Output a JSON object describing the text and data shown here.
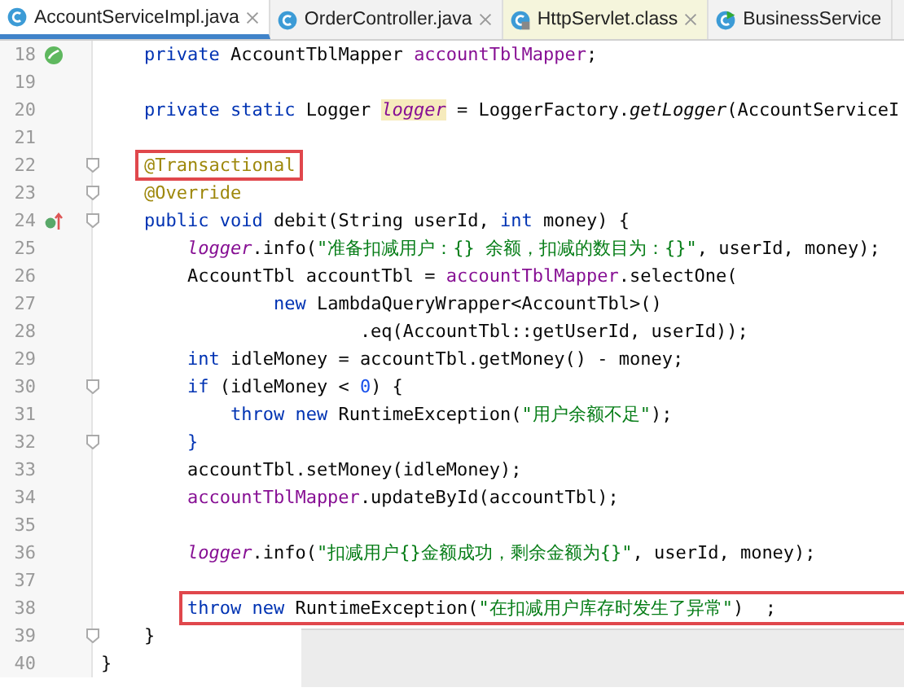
{
  "tabs": [
    {
      "label": "AccountServiceImpl.java",
      "selected": true,
      "kind": "java",
      "closable": true
    },
    {
      "label": "OrderController.java",
      "selected": false,
      "kind": "java",
      "closable": true
    },
    {
      "label": "HttpServlet.class",
      "selected": false,
      "kind": "class",
      "closable": true
    },
    {
      "label": "BusinessService",
      "selected": false,
      "kind": "java-run",
      "closable": false
    }
  ],
  "editor": {
    "lines": [
      {
        "number": "18",
        "gutter_icon": {
          "kind": "bean"
        },
        "fold": false,
        "boxed": false,
        "tokens": [
          {
            "kind": "kw",
            "text": "    private "
          },
          {
            "kind": "plain",
            "text": "AccountTblMapper "
          },
          {
            "kind": "field",
            "text": "accountTblMapper"
          },
          {
            "kind": "plain",
            "text": ";"
          }
        ]
      },
      {
        "number": "19",
        "fold": false
      },
      {
        "number": "20",
        "fold": false,
        "boxed": false,
        "tokens": [
          {
            "kind": "kw",
            "text": "    private static "
          },
          {
            "kind": "plain",
            "text": "Logger "
          },
          {
            "kind": "static-marked",
            "text": "logger"
          },
          {
            "kind": "plain",
            "text": " = LoggerFactory."
          },
          {
            "kind": "method-italic",
            "text": "getLogger"
          },
          {
            "kind": "plain",
            "text": "(AccountServiceI"
          }
        ]
      },
      {
        "number": "21",
        "fold": false
      },
      {
        "number": "22",
        "fold": true,
        "boxed": true,
        "tokens": [
          {
            "kind": "annotation",
            "text": "    @Transactional"
          }
        ]
      },
      {
        "number": "23",
        "fold": true,
        "boxed": false,
        "tokens": [
          {
            "kind": "annotation",
            "text": "    @Override"
          }
        ]
      },
      {
        "number": "24",
        "gutter_icon": {
          "kind": "override"
        },
        "fold": true,
        "boxed": false,
        "tokens": [
          {
            "kind": "kw",
            "text": "    public void "
          },
          {
            "kind": "plain",
            "text": "debit(String userId, "
          },
          {
            "kind": "kw",
            "text": "int "
          },
          {
            "kind": "plain",
            "text": "money) {"
          }
        ]
      },
      {
        "number": "25",
        "fold": false,
        "boxed": false,
        "tokens": [
          {
            "kind": "static",
            "text": "        logger"
          },
          {
            "kind": "plain",
            "text": ".info("
          },
          {
            "kind": "string",
            "text": "\"准备扣减用户：{} 余额，扣减的数目为：{}\""
          },
          {
            "kind": "plain",
            "text": ", userId, money);"
          }
        ]
      },
      {
        "number": "26",
        "fold": false,
        "boxed": false,
        "tokens": [
          {
            "kind": "plain",
            "text": "        AccountTbl accountTbl = "
          },
          {
            "kind": "field",
            "text": "accountTblMapper"
          },
          {
            "kind": "plain",
            "text": ".selectOne("
          }
        ]
      },
      {
        "number": "27",
        "fold": false,
        "boxed": false,
        "tokens": [
          {
            "kind": "kw",
            "text": "                new "
          },
          {
            "kind": "plain",
            "text": "LambdaQueryWrapper<AccountTbl>()"
          }
        ]
      },
      {
        "number": "28",
        "fold": false,
        "boxed": false,
        "tokens": [
          {
            "kind": "plain",
            "text": "                        .eq(AccountTbl::getUserId, userId));"
          }
        ]
      },
      {
        "number": "29",
        "fold": false,
        "boxed": false,
        "tokens": [
          {
            "kind": "kw",
            "text": "        int "
          },
          {
            "kind": "plain",
            "text": "idleMoney = accountTbl.getMoney() - money;"
          }
        ]
      },
      {
        "number": "30",
        "fold": true,
        "boxed": false,
        "tokens": [
          {
            "kind": "kw",
            "text": "        if "
          },
          {
            "kind": "plain",
            "text": "(idleMoney < "
          },
          {
            "kind": "number",
            "text": "0"
          },
          {
            "kind": "plain",
            "text": ") {"
          }
        ]
      },
      {
        "number": "31",
        "fold": false,
        "boxed": false,
        "tokens": [
          {
            "kind": "kw",
            "text": "            throw new "
          },
          {
            "kind": "plain",
            "text": "RuntimeException("
          },
          {
            "kind": "string",
            "text": "\"用户余额不足\""
          },
          {
            "kind": "plain",
            "text": ");"
          }
        ]
      },
      {
        "number": "32",
        "fold": true,
        "boxed": false,
        "tokens": [
          {
            "kind": "kw",
            "text": "        }"
          }
        ]
      },
      {
        "number": "33",
        "fold": false,
        "boxed": false,
        "tokens": [
          {
            "kind": "plain",
            "text": "        accountTbl.setMoney(idleMoney);"
          }
        ]
      },
      {
        "number": "34",
        "fold": false,
        "boxed": false,
        "tokens": [
          {
            "kind": "field",
            "text": "        accountTblMapper"
          },
          {
            "kind": "plain",
            "text": ".updateById(accountTbl);"
          }
        ]
      },
      {
        "number": "35",
        "fold": false
      },
      {
        "number": "36",
        "fold": false,
        "boxed": false,
        "tokens": [
          {
            "kind": "static",
            "text": "        logger"
          },
          {
            "kind": "plain",
            "text": ".info("
          },
          {
            "kind": "string",
            "text": "\"扣减用户{}金额成功，剩余金额为{}\""
          },
          {
            "kind": "plain",
            "text": ", userId, money);"
          }
        ]
      },
      {
        "number": "37",
        "fold": false
      },
      {
        "number": "38",
        "fold": false,
        "boxed": true,
        "tokens": [
          {
            "kind": "kw",
            "text": "        throw new "
          },
          {
            "kind": "plain",
            "text": "RuntimeException("
          },
          {
            "kind": "string",
            "text": "\"在扣减用户库存时发生了异常\""
          },
          {
            "kind": "plain",
            "text": ")  ;"
          }
        ]
      },
      {
        "number": "39",
        "fold": true,
        "boxed": false,
        "tokens": [
          {
            "kind": "plain",
            "text": "    }"
          }
        ]
      },
      {
        "number": "40",
        "fold": false,
        "boxed": false,
        "tokens": [
          {
            "kind": "plain",
            "text": "}"
          }
        ]
      }
    ]
  }
}
